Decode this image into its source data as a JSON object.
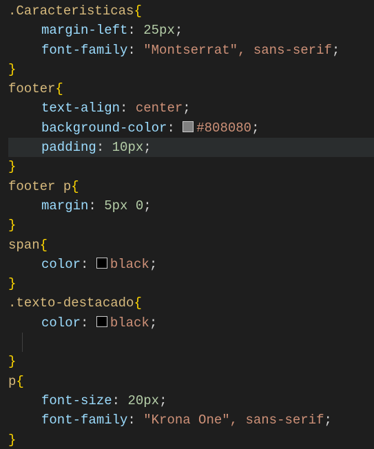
{
  "lines": [
    {
      "type": "sel-open",
      "selector": ".Caracteristicas"
    },
    {
      "type": "decl",
      "prop": "margin-left",
      "valNum": "25",
      "valUnit": "px"
    },
    {
      "type": "decl",
      "prop": "font-family",
      "valStr": "\"Montserrat\"",
      "valTrail": ", sans-serif"
    },
    {
      "type": "close"
    },
    {
      "type": "sel-open",
      "selector": "footer"
    },
    {
      "type": "decl",
      "prop": "text-align",
      "valKw": "center"
    },
    {
      "type": "decl",
      "prop": "background-color",
      "swatch": "#808080",
      "valColor": "#808080"
    },
    {
      "type": "decl",
      "prop": "padding",
      "valNum": "10",
      "valUnit": "px",
      "highlight": true
    },
    {
      "type": "close"
    },
    {
      "type": "sel-open",
      "selector": "footer p"
    },
    {
      "type": "decl",
      "prop": "margin",
      "valNum": "5",
      "valUnit": "px",
      "valTrailNum": " 0"
    },
    {
      "type": "close"
    },
    {
      "type": "sel-open",
      "selector": "span"
    },
    {
      "type": "decl",
      "prop": "color",
      "swatch": "#000000",
      "valKw": "black"
    },
    {
      "type": "close"
    },
    {
      "type": "sel-open",
      "selector": ".texto-destacado"
    },
    {
      "type": "decl",
      "prop": "color",
      "swatch": "#000000",
      "valKw": "black"
    },
    {
      "type": "blank"
    },
    {
      "type": "close"
    },
    {
      "type": "sel-open",
      "selector": "p"
    },
    {
      "type": "decl",
      "prop": "font-size",
      "valNum": "20",
      "valUnit": "px"
    },
    {
      "type": "decl",
      "prop": "font-family",
      "valStr": "\"Krona One\"",
      "valTrail": ", sans-serif"
    },
    {
      "type": "close"
    }
  ]
}
